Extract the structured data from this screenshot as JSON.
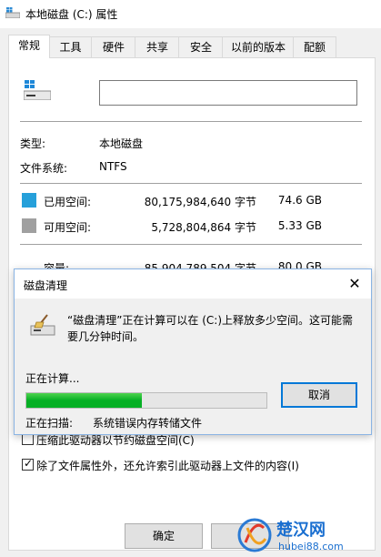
{
  "window": {
    "title": "本地磁盘 (C:) 属性"
  },
  "tabs": [
    {
      "label": "常规",
      "active": true
    },
    {
      "label": "工具"
    },
    {
      "label": "硬件"
    },
    {
      "label": "共享"
    },
    {
      "label": "安全"
    },
    {
      "label": "以前的版本"
    },
    {
      "label": "配额"
    }
  ],
  "general": {
    "volume_name_value": "",
    "type_label": "类型:",
    "type_value": "本地磁盘",
    "fs_label": "文件系统:",
    "fs_value": "NTFS",
    "used_label": "已用空间:",
    "used_bytes": "80,175,984,640 字节",
    "used_size": "74.6 GB",
    "free_label": "可用空间:",
    "free_bytes": "5,728,804,864 字节",
    "free_size": "5.33 GB",
    "capacity_label": "容量:",
    "capacity_bytes": "85,904,789,504 字节",
    "capacity_size": "80.0 GB",
    "used_color": "#26a0da",
    "free_color": "#a0a0a0",
    "compress_label": "压缩此驱动器以节约磁盘空间(C)",
    "compress_checked": false,
    "index_label": "除了文件属性外，还允许索引此驱动器上文件的内容(I)",
    "index_checked": true
  },
  "dialog": {
    "title": "磁盘清理",
    "message": "“磁盘清理”正在计算可以在 (C:)上释放多少空间。这可能需要几分钟时间。",
    "calculating_label": "正在计算...",
    "progress": 0.48,
    "cancel_label": "取消",
    "scanning_label": "正在扫描:",
    "scanning_value": "系统错误内存转储文件",
    "close_icon": "close-icon"
  },
  "buttons": {
    "ok_label": "确定"
  }
}
